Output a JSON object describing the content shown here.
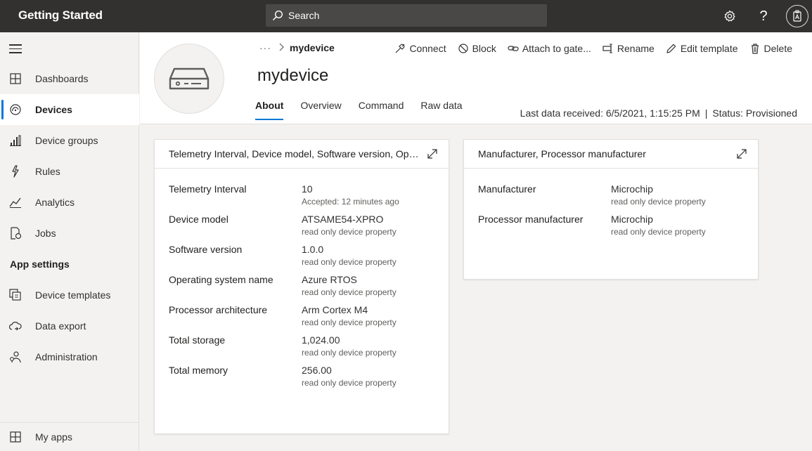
{
  "app": {
    "title": "Getting Started"
  },
  "search": {
    "placeholder": "Search"
  },
  "sidebar": {
    "items": [
      {
        "label": "Dashboards",
        "icon": "dashboard-icon"
      },
      {
        "label": "Devices",
        "icon": "devices-icon",
        "active": true
      },
      {
        "label": "Device groups",
        "icon": "device-groups-icon"
      },
      {
        "label": "Rules",
        "icon": "rules-icon"
      },
      {
        "label": "Analytics",
        "icon": "analytics-icon"
      },
      {
        "label": "Jobs",
        "icon": "jobs-icon"
      }
    ],
    "section_label": "App settings",
    "settings_items": [
      {
        "label": "Device templates",
        "icon": "device-templates-icon"
      },
      {
        "label": "Data export",
        "icon": "data-export-icon"
      },
      {
        "label": "Administration",
        "icon": "administration-icon"
      }
    ],
    "footer": {
      "label": "My apps",
      "icon": "my-apps-icon"
    }
  },
  "breadcrumb": {
    "ellipsis": "···",
    "current": "mydevice"
  },
  "device": {
    "name": "mydevice"
  },
  "commands": {
    "connect": "Connect",
    "block": "Block",
    "attach": "Attach to gate...",
    "rename": "Rename",
    "edit_template": "Edit template",
    "delete": "Delete"
  },
  "tabs": [
    "About",
    "Overview",
    "Command",
    "Raw data"
  ],
  "status": {
    "last_data": "Last data received: 6/5/2021, 1:15:25 PM",
    "separator": "|",
    "status": "Status: Provisioned"
  },
  "cards": [
    {
      "title": "Telemetry Interval, Device model, Software version, Oper...",
      "rows": [
        {
          "label": "Telemetry Interval",
          "value": "10",
          "sub": "Accepted: 12 minutes ago"
        },
        {
          "label": "Device model",
          "value": "ATSAME54-XPRO",
          "sub": "read only device property"
        },
        {
          "label": "Software version",
          "value": "1.0.0",
          "sub": "read only device property"
        },
        {
          "label": "Operating system name",
          "value": "Azure RTOS",
          "sub": "read only device property"
        },
        {
          "label": "Processor architecture",
          "value": "Arm Cortex M4",
          "sub": "read only device property"
        },
        {
          "label": "Total storage",
          "value": "1,024.00",
          "sub": "read only device property"
        },
        {
          "label": "Total memory",
          "value": "256.00",
          "sub": "read only device property"
        }
      ]
    },
    {
      "title": "Manufacturer, Processor manufacturer",
      "rows": [
        {
          "label": "Manufacturer",
          "value": "Microchip",
          "sub": "read only device property"
        },
        {
          "label": "Processor manufacturer",
          "value": "Microchip",
          "sub": "read only device property"
        }
      ]
    }
  ],
  "colors": {
    "topbar": "#323130",
    "accent": "#0078d4",
    "sidebar_bg": "#f3f2f1"
  }
}
